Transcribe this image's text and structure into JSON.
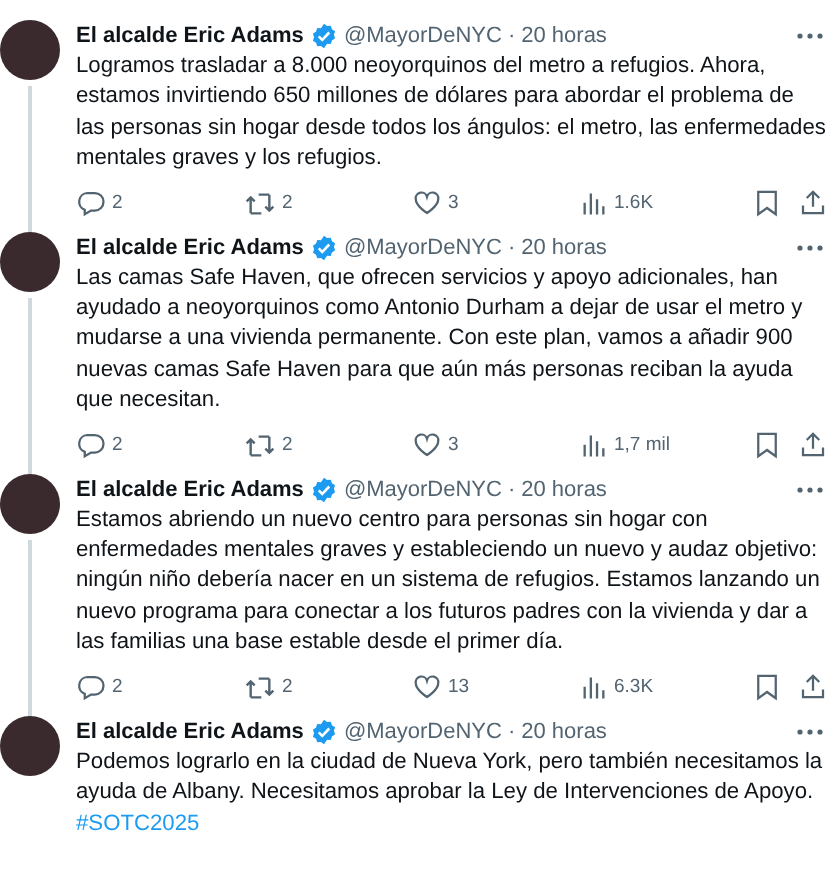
{
  "tweets": [
    {
      "name": "El alcalde Eric Adams",
      "handle": "@MayorDeNYC",
      "separator": "·",
      "time": "20 horas",
      "text": "Logramos trasladar a 8.000 neoyorquinos del metro a refugios. Ahora, estamos invirtiendo 650 millones de dólares para abordar el problema de las personas sin hogar desde todos los ángulos: el metro, las enfermedades mentales graves y los refugios.",
      "stats": {
        "replies": "2",
        "reposts": "2",
        "likes": "3",
        "views": "1.6K"
      },
      "thread_continues": true
    },
    {
      "name": "El alcalde Eric Adams",
      "handle": "@MayorDeNYC",
      "separator": "·",
      "time": "20 horas",
      "text": "Las camas Safe Haven, que ofrecen servicios y apoyo adicionales, han ayudado a neoyorquinos como Antonio Durham a dejar de usar el metro y mudarse a una vivienda permanente. Con este plan, vamos a añadir 900 nuevas camas Safe Haven para que aún más personas reciban la ayuda que necesitan.",
      "stats": {
        "replies": "2",
        "reposts": "2",
        "likes": "3",
        "views": "1,7 mil"
      },
      "thread_continues": true
    },
    {
      "name": "El alcalde Eric Adams",
      "handle": "@MayorDeNYC",
      "separator": "·",
      "time": "20 horas",
      "text": "Estamos abriendo un nuevo centro para personas sin hogar con enfermedades mentales graves y estableciendo un nuevo y audaz objetivo: ningún niño debería nacer en un sistema de refugios. Estamos lanzando un nuevo programa para conectar a los futuros padres con la vivienda y dar a las familias una base estable desde el primer día.",
      "stats": {
        "replies": "2",
        "reposts": "2",
        "likes": "13",
        "views": "6.3K"
      },
      "thread_continues": true
    },
    {
      "name": "El alcalde Eric Adams",
      "handle": "@MayorDeNYC",
      "separator": "·",
      "time": "20 horas",
      "text": "Podemos lograrlo en la ciudad de Nueva York, pero también necesitamos la ayuda de Albany. Necesitamos aprobar la Ley de Intervenciones de Apoyo.",
      "hashtag": "#SOTC2025",
      "thread_continues": false
    }
  ]
}
